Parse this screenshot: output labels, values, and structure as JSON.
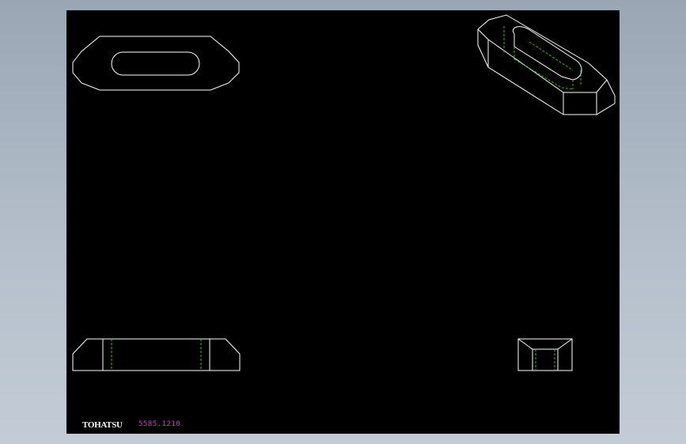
{
  "drawing": {
    "brand": "TOHATSU",
    "part_number": "5585.1210",
    "colors": {
      "background": "#000000",
      "outline": "#ffffff",
      "hidden_line": "#1fbf2a",
      "part_number": "#d63ad6"
    }
  }
}
